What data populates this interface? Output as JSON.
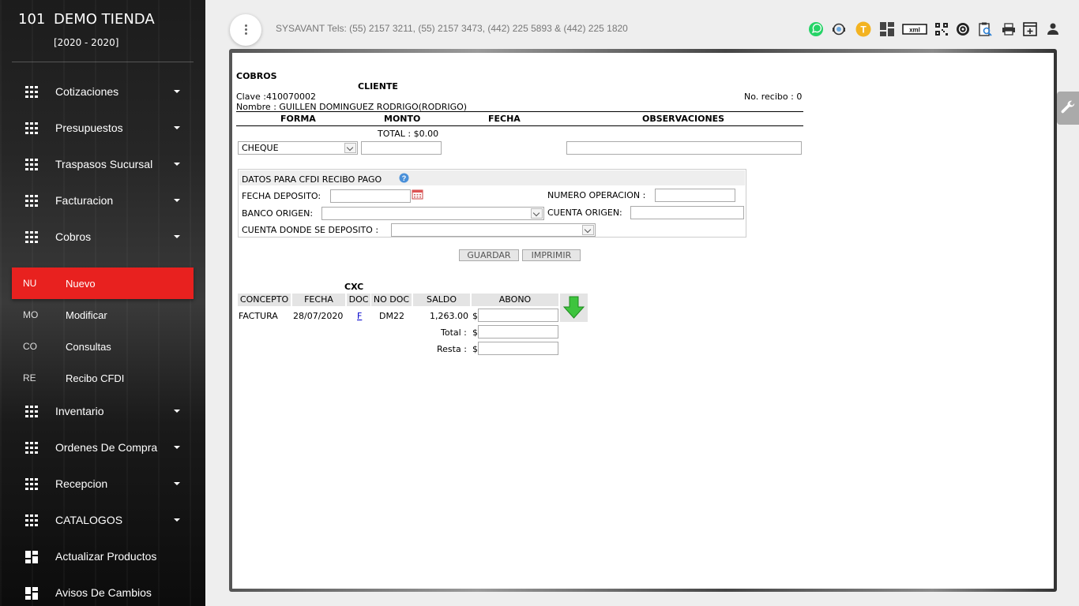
{
  "brand": {
    "number": "101",
    "name": "DEMO TIENDA",
    "years": "[2020 - 2020]"
  },
  "nav": [
    {
      "label": "Cotizaciones"
    },
    {
      "label": "Presupuestos"
    },
    {
      "label": "Traspasos Sucursal"
    },
    {
      "label": "Facturacion"
    },
    {
      "label": "Cobros"
    },
    {
      "label": "Inventario"
    },
    {
      "label": "Ordenes De Compra"
    },
    {
      "label": "Recepcion"
    },
    {
      "label": "CATALOGOS"
    },
    {
      "label": "Actualizar Productos"
    },
    {
      "label": "Avisos De Cambios"
    }
  ],
  "submenu": [
    {
      "abbr": "NU",
      "label": "Nuevo"
    },
    {
      "abbr": "MO",
      "label": "Modificar"
    },
    {
      "abbr": "CO",
      "label": "Consultas"
    },
    {
      "abbr": "RE",
      "label": "Recibo CFDI"
    }
  ],
  "topbar": {
    "text": "SYSAVANT Tels: (55) 2157 3211, (55) 2157 3473, (442) 225 5893 & (442) 225 1820",
    "icons": [
      "whatsapp-icon",
      "support-agent-icon",
      "t-badge-icon",
      "dashboard-icon",
      "xml-icon",
      "qr-code-icon",
      "settings-circle-icon",
      "clipboard-search-icon",
      "print-icon",
      "new-window-icon",
      "user-icon"
    ]
  },
  "form": {
    "title": "COBROS",
    "cliente_header": "CLIENTE",
    "clave": "Clave :410070002",
    "nombre": "Nombre : GUILLEN DOMINGUEZ RODRIGO(RODRIGO)",
    "recibo": "No. recibo : 0",
    "col_forma": "FORMA",
    "col_monto": "MONTO",
    "col_fecha": "FECHA",
    "col_obs": "OBSERVACIONES",
    "total": "TOTAL : $0.00",
    "forma_value": "CHEQUE",
    "cfdi": {
      "title": "DATOS PARA CFDI RECIBO PAGO",
      "fecha_deposito": "FECHA DEPOSITO:",
      "numero_operacion": "NUMERO OPERACION :",
      "banco_origen": "BANCO ORIGEN:",
      "cuenta_origen": "CUENTA ORIGEN:",
      "cuenta_deposito": "CUENTA DONDE SE DEPOSITO :"
    },
    "guardar": "GUARDAR",
    "imprimir": "IMPRIMIR"
  },
  "cxc": {
    "title": "CXC",
    "headers": [
      "CONCEPTO",
      "FECHA",
      "DOC",
      "NO DOC",
      "SALDO",
      "ABONO"
    ],
    "row": {
      "concepto": "FACTURA",
      "fecha": "28/07/2020",
      "doc": "F",
      "nodoc": "DM22",
      "saldo": "1,263.00",
      "currency": "$"
    },
    "total_label": "Total :",
    "resta_label": "Resta :",
    "currency": "$"
  }
}
